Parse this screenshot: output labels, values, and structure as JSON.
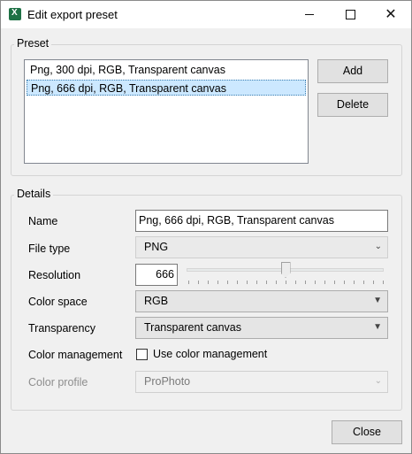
{
  "window": {
    "title": "Edit export preset",
    "min_icon": "minimize-icon",
    "max_icon": "maximize-icon",
    "close_glyph": "✕"
  },
  "preset": {
    "legend": "Preset",
    "items": [
      {
        "label": "Png, 300 dpi, RGB, Transparent canvas",
        "selected": false
      },
      {
        "label": "Png, 666 dpi, RGB, Transparent canvas",
        "selected": true
      }
    ],
    "add_label": "Add",
    "delete_label": "Delete"
  },
  "details": {
    "legend": "Details",
    "name_label": "Name",
    "name_value": "Png, 666 dpi, RGB, Transparent canvas",
    "filetype_label": "File type",
    "filetype_value": "PNG",
    "resolution_label": "Resolution",
    "resolution_value": "666",
    "resolution_slider_fraction": 0.5,
    "colorspace_label": "Color space",
    "colorspace_value": "RGB",
    "transparency_label": "Transparency",
    "transparency_value": "Transparent canvas",
    "colormgmt_label": "Color management",
    "colormgmt_checkbox_label": "Use color management",
    "colormgmt_checked": false,
    "colorprofile_label": "Color profile",
    "colorprofile_value": "ProPhoto"
  },
  "footer": {
    "close_label": "Close"
  },
  "colors": {
    "selection_bg": "#cce8ff",
    "app_icon": "#1e7145"
  }
}
